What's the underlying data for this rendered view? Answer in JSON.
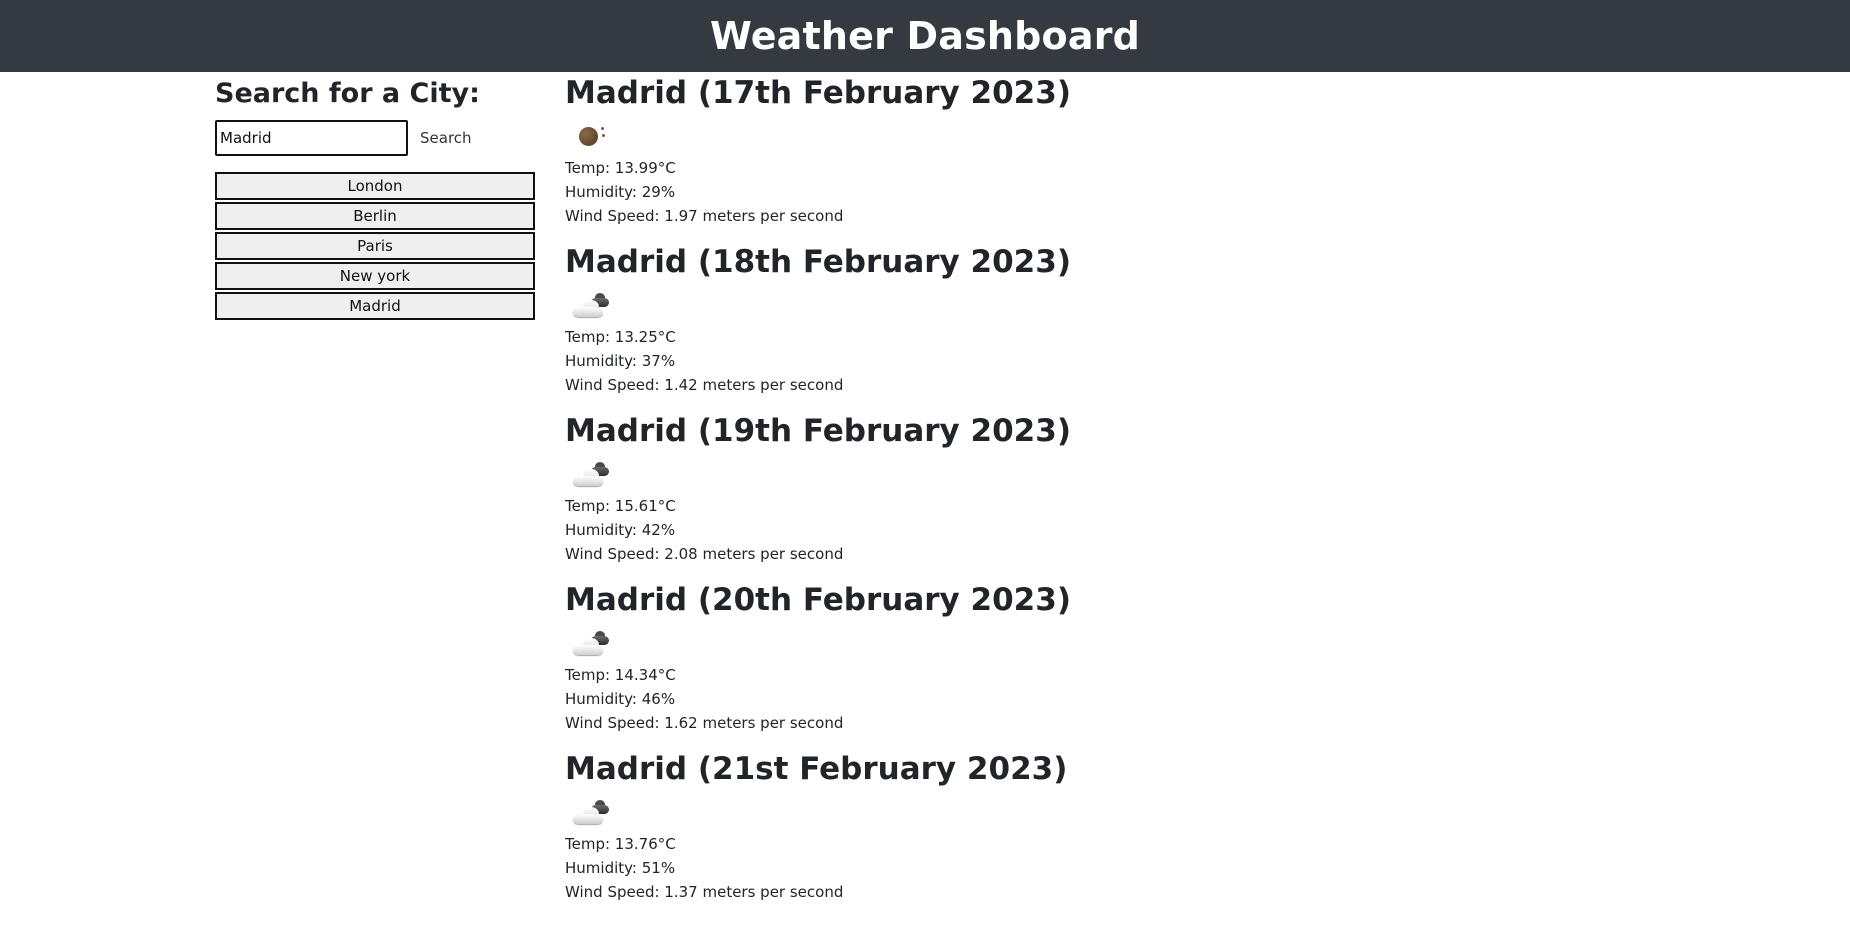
{
  "header": {
    "title": "Weather Dashboard"
  },
  "sidebar": {
    "heading": "Search for a City:",
    "search": {
      "value": "Madrid",
      "placeholder": ""
    },
    "search_label": "Search",
    "history": [
      "London",
      "Berlin",
      "Paris",
      "New york",
      "Madrid"
    ]
  },
  "forecast": [
    {
      "title": "Madrid (17th February 2023)",
      "icon": "clear-sky-icon",
      "temp": "Temp: 13.99°C",
      "humidity": "Humidity: 29%",
      "wind": "Wind Speed: 1.97 meters per second"
    },
    {
      "title": "Madrid (18th February 2023)",
      "icon": "broken-clouds-icon",
      "temp": "Temp: 13.25°C",
      "humidity": "Humidity: 37%",
      "wind": "Wind Speed: 1.42 meters per second"
    },
    {
      "title": "Madrid (19th February 2023)",
      "icon": "broken-clouds-icon",
      "temp": "Temp: 15.61°C",
      "humidity": "Humidity: 42%",
      "wind": "Wind Speed: 2.08 meters per second"
    },
    {
      "title": "Madrid (20th February 2023)",
      "icon": "broken-clouds-icon",
      "temp": "Temp: 14.34°C",
      "humidity": "Humidity: 46%",
      "wind": "Wind Speed: 1.62 meters per second"
    },
    {
      "title": "Madrid (21st February 2023)",
      "icon": "broken-clouds-icon",
      "temp": "Temp: 13.76°C",
      "humidity": "Humidity: 51%",
      "wind": "Wind Speed: 1.37 meters per second"
    }
  ],
  "colors": {
    "header_bg": "#343a40",
    "header_text": "#ffffff",
    "history_bg": "#efefef"
  }
}
